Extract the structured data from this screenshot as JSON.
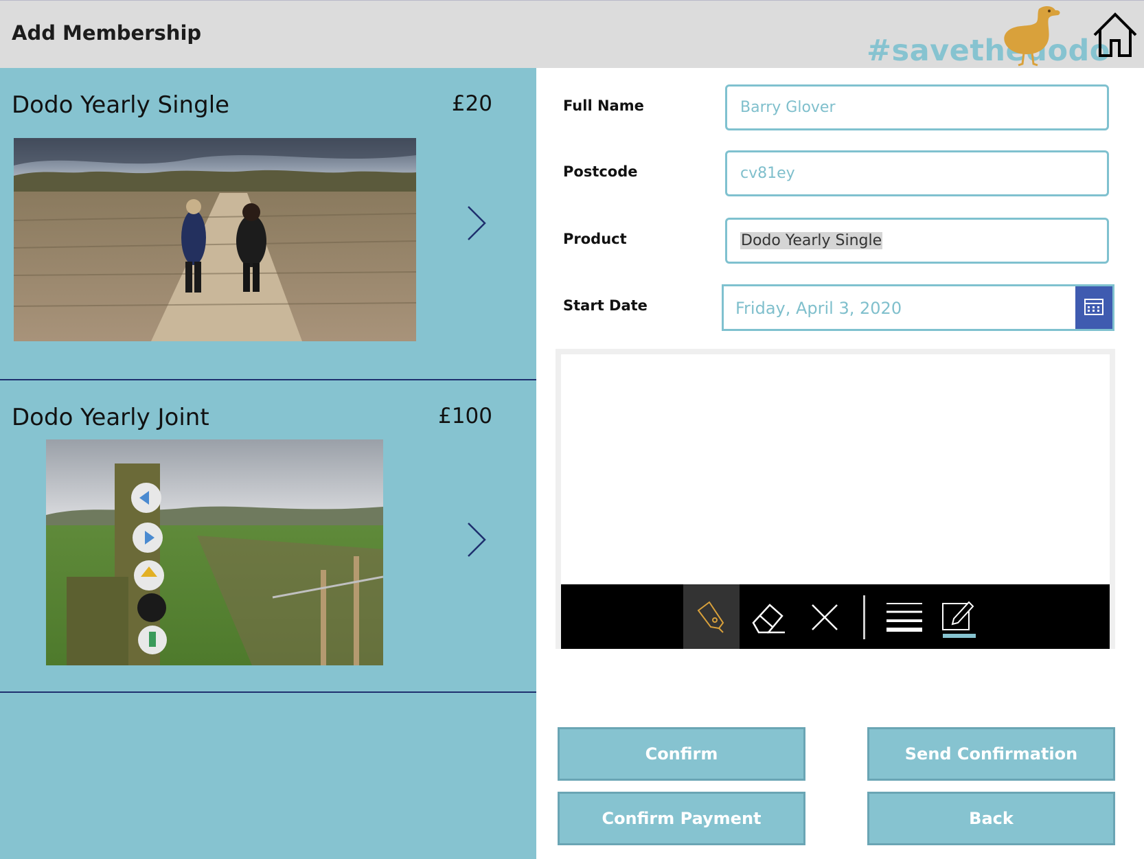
{
  "header": {
    "title": "Add Membership",
    "hashtag": "#savethedodo"
  },
  "memberships": [
    {
      "name": "Dodo Yearly Single",
      "price": "£20"
    },
    {
      "name": "Dodo Yearly Joint",
      "price": "£100"
    }
  ],
  "form": {
    "full_name_label": "Full Name",
    "full_name_value": "Barry Glover",
    "postcode_label": "Postcode",
    "postcode_value": "cv81ey",
    "product_label": "Product",
    "product_value": "Dodo Yearly Single",
    "start_date_label": "Start Date",
    "start_date_value": "Friday, April 3, 2020"
  },
  "pen_toolbar": {
    "tools": [
      "pen-icon",
      "eraser-icon",
      "clear-icon",
      "thickness-icon",
      "color-icon"
    ],
    "active_tool": "pen-icon"
  },
  "buttons": {
    "confirm": "Confirm",
    "send_confirmation": "Send Confirmation",
    "confirm_payment": "Confirm Payment",
    "back": "Back"
  },
  "colors": {
    "accent": "#86c3d0",
    "header_bg": "#dcdcdc",
    "calendar_button": "#3f5bb0",
    "dodo": "#d9a13b",
    "divider": "#1e2f6e"
  }
}
